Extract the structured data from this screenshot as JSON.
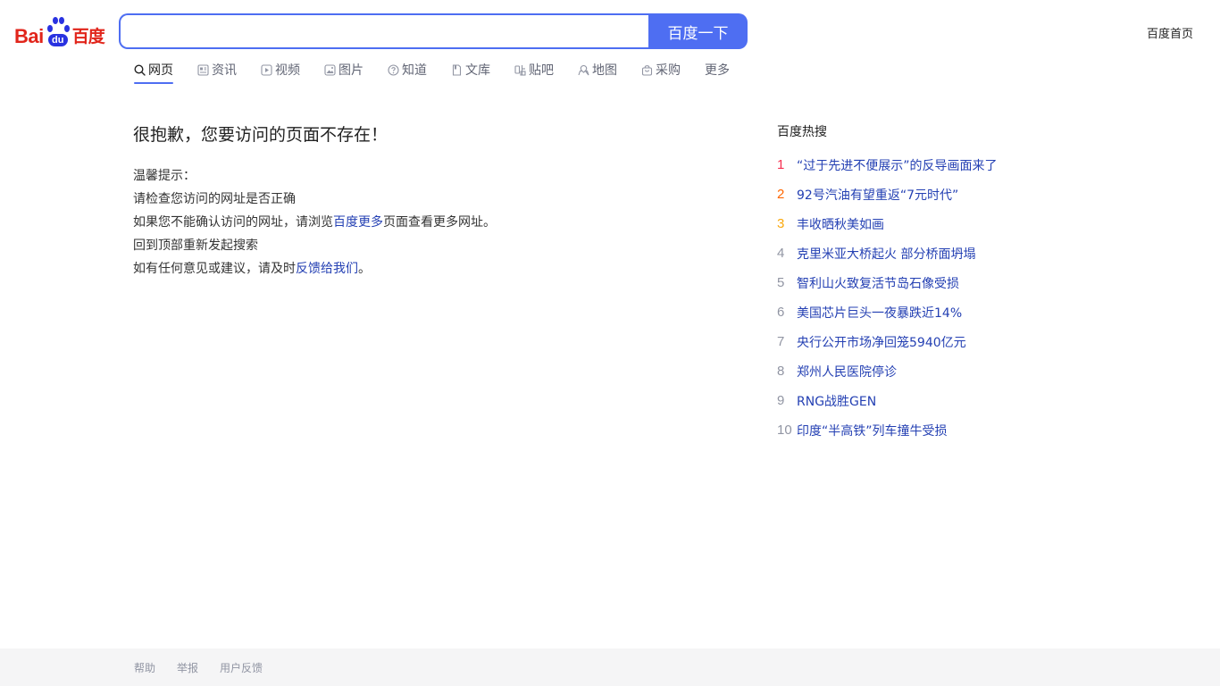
{
  "header": {
    "logo": {
      "latin": "Bai",
      "paw_text": "du",
      "chinese": "百度",
      "colors": {
        "red": "#e1251b",
        "blue": "#2932e1"
      }
    },
    "search": {
      "value": "",
      "placeholder": "",
      "button_label": "百度一下"
    },
    "home_link": "百度首页"
  },
  "tabs": [
    {
      "label": "网页",
      "icon": "search-icon",
      "active": true
    },
    {
      "label": "资讯",
      "icon": "news-icon",
      "active": false
    },
    {
      "label": "视频",
      "icon": "video-icon",
      "active": false
    },
    {
      "label": "图片",
      "icon": "image-icon",
      "active": false
    },
    {
      "label": "知道",
      "icon": "question-icon",
      "active": false
    },
    {
      "label": "文库",
      "icon": "document-icon",
      "active": false
    },
    {
      "label": "贴吧",
      "icon": "tieba-icon",
      "active": false
    },
    {
      "label": "地图",
      "icon": "map-icon",
      "active": false
    },
    {
      "label": "采购",
      "icon": "shopping-bag-icon",
      "active": false
    },
    {
      "label": "更多",
      "icon": "",
      "active": false
    }
  ],
  "main": {
    "error_title": "很抱歉，您要访问的页面不存在！",
    "tips_heading": "温馨提示：",
    "tip_check_url": "请检查您访问的网址是否正确",
    "tip_browse_prefix": "如果您不能确认访问的网址，请浏览",
    "tip_browse_link": "百度更多",
    "tip_browse_suffix": "页面查看更多网址。",
    "tip_search_again": "回到顶部重新发起搜索",
    "tip_feedback_prefix": "如有任何意见或建议，请及时",
    "tip_feedback_link": "反馈给我们",
    "tip_feedback_suffix": "。"
  },
  "hot_search": {
    "title": "百度热搜",
    "items": [
      {
        "rank": "1",
        "text": "“过于先进不便展示”的反导画面来了"
      },
      {
        "rank": "2",
        "text": "92号汽油有望重返“7元时代”"
      },
      {
        "rank": "3",
        "text": "丰收晒秋美如画"
      },
      {
        "rank": "4",
        "text": "克里米亚大桥起火 部分桥面坍塌"
      },
      {
        "rank": "5",
        "text": "智利山火致复活节岛石像受损"
      },
      {
        "rank": "6",
        "text": "美国芯片巨头一夜暴跌近14%"
      },
      {
        "rank": "7",
        "text": "央行公开市场净回笼5940亿元"
      },
      {
        "rank": "8",
        "text": "郑州人民医院停诊"
      },
      {
        "rank": "9",
        "text": "RNG战胜GEN"
      },
      {
        "rank": "10",
        "text": "印度“半高铁”列车撞牛受损"
      }
    ],
    "rank_colors": {
      "1": "#f63051",
      "2": "#ff6600",
      "3": "#faa90e",
      "other": "#9195a3"
    }
  },
  "footer": {
    "links": [
      "帮助",
      "举报",
      "用户反馈"
    ]
  },
  "colors": {
    "accent": "#4e6ef2",
    "link": "#2440b3",
    "muted": "#626675",
    "footer_bg": "#f5f5f6"
  }
}
